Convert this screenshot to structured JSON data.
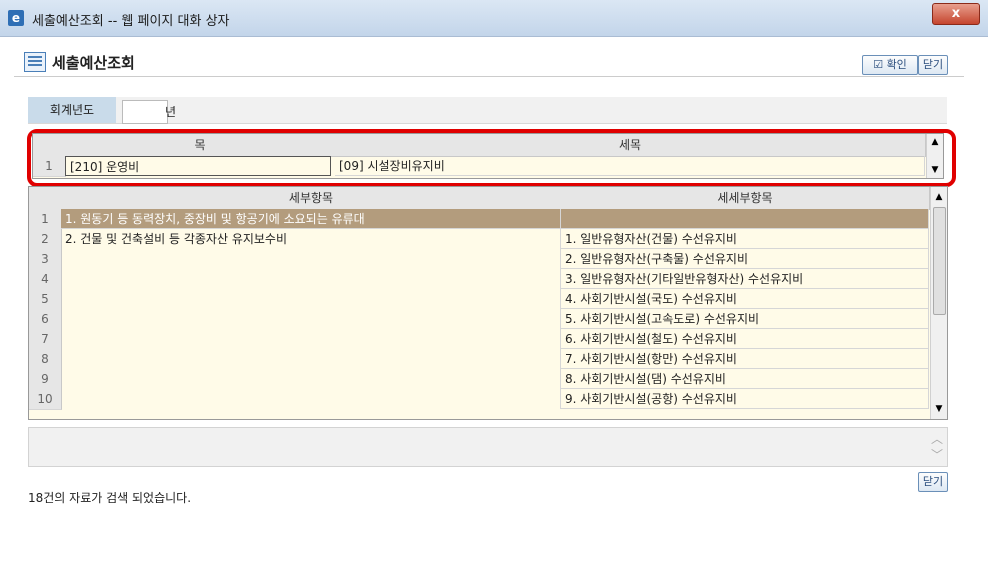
{
  "window": {
    "title": "세출예산조회 -- 웹 페이지 대화 상자",
    "close_label": "x"
  },
  "header": {
    "title": "세출예산조회",
    "confirm_label": "확인",
    "close_label": "닫기"
  },
  "year": {
    "label": "회계년도",
    "value": "",
    "unit": "년"
  },
  "grid1": {
    "columns": [
      "목",
      "세목"
    ],
    "rows": [
      {
        "num": "1",
        "mok": "[210] 운영비",
        "semok": "[09] 시설장비유지비"
      }
    ]
  },
  "grid2": {
    "columns": [
      "세부항목",
      "세세부항목"
    ],
    "rows": [
      {
        "num": "1",
        "a": "1. 원동기 등 동력장치, 중장비 및 항공기에 소요되는 유류대",
        "b": ""
      },
      {
        "num": "2",
        "a": "2. 건물 및 건축설비 등 각종자산 유지보수비",
        "b": "1. 일반유형자산(건물) 수선유지비"
      },
      {
        "num": "3",
        "a": "",
        "b": "2. 일반유형자산(구축물) 수선유지비"
      },
      {
        "num": "4",
        "a": "",
        "b": "3. 일반유형자산(기타일반유형자산) 수선유지비"
      },
      {
        "num": "5",
        "a": "",
        "b": "4. 사회기반시설(국도) 수선유지비"
      },
      {
        "num": "6",
        "a": "",
        "b": "5. 사회기반시설(고속도로) 수선유지비"
      },
      {
        "num": "7",
        "a": "",
        "b": "6. 사회기반시설(철도) 수선유지비"
      },
      {
        "num": "8",
        "a": "",
        "b": "7. 사회기반시설(항만) 수선유지비"
      },
      {
        "num": "9",
        "a": "",
        "b": "8. 사회기반시설(댐) 수선유지비"
      },
      {
        "num": "10",
        "a": "",
        "b": "9. 사회기반시설(공항) 수선유지비"
      }
    ]
  },
  "footer": {
    "close_label": "닫기",
    "status": "18건의 자료가 검색 되었습니다."
  },
  "colors": {
    "highlight_border": "#e00000",
    "selected_row": "#b39c7d",
    "grid_bg": "#fffbe8"
  }
}
